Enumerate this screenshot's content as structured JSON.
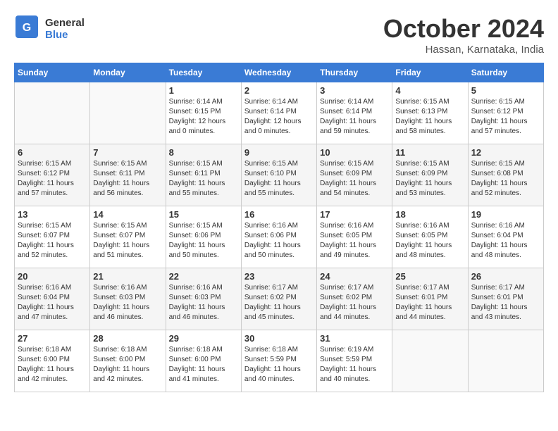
{
  "header": {
    "logo": {
      "general": "General",
      "blue": "Blue"
    },
    "title": "October 2024",
    "location": "Hassan, Karnataka, India"
  },
  "calendar": {
    "days_of_week": [
      "Sunday",
      "Monday",
      "Tuesday",
      "Wednesday",
      "Thursday",
      "Friday",
      "Saturday"
    ],
    "weeks": [
      [
        {
          "day": "",
          "sunrise": "",
          "sunset": "",
          "daylight": ""
        },
        {
          "day": "",
          "sunrise": "",
          "sunset": "",
          "daylight": ""
        },
        {
          "day": "1",
          "sunrise": "Sunrise: 6:14 AM",
          "sunset": "Sunset: 6:15 PM",
          "daylight": "Daylight: 12 hours and 0 minutes."
        },
        {
          "day": "2",
          "sunrise": "Sunrise: 6:14 AM",
          "sunset": "Sunset: 6:14 PM",
          "daylight": "Daylight: 12 hours and 0 minutes."
        },
        {
          "day": "3",
          "sunrise": "Sunrise: 6:14 AM",
          "sunset": "Sunset: 6:14 PM",
          "daylight": "Daylight: 11 hours and 59 minutes."
        },
        {
          "day": "4",
          "sunrise": "Sunrise: 6:15 AM",
          "sunset": "Sunset: 6:13 PM",
          "daylight": "Daylight: 11 hours and 58 minutes."
        },
        {
          "day": "5",
          "sunrise": "Sunrise: 6:15 AM",
          "sunset": "Sunset: 6:12 PM",
          "daylight": "Daylight: 11 hours and 57 minutes."
        }
      ],
      [
        {
          "day": "6",
          "sunrise": "Sunrise: 6:15 AM",
          "sunset": "Sunset: 6:12 PM",
          "daylight": "Daylight: 11 hours and 57 minutes."
        },
        {
          "day": "7",
          "sunrise": "Sunrise: 6:15 AM",
          "sunset": "Sunset: 6:11 PM",
          "daylight": "Daylight: 11 hours and 56 minutes."
        },
        {
          "day": "8",
          "sunrise": "Sunrise: 6:15 AM",
          "sunset": "Sunset: 6:11 PM",
          "daylight": "Daylight: 11 hours and 55 minutes."
        },
        {
          "day": "9",
          "sunrise": "Sunrise: 6:15 AM",
          "sunset": "Sunset: 6:10 PM",
          "daylight": "Daylight: 11 hours and 55 minutes."
        },
        {
          "day": "10",
          "sunrise": "Sunrise: 6:15 AM",
          "sunset": "Sunset: 6:09 PM",
          "daylight": "Daylight: 11 hours and 54 minutes."
        },
        {
          "day": "11",
          "sunrise": "Sunrise: 6:15 AM",
          "sunset": "Sunset: 6:09 PM",
          "daylight": "Daylight: 11 hours and 53 minutes."
        },
        {
          "day": "12",
          "sunrise": "Sunrise: 6:15 AM",
          "sunset": "Sunset: 6:08 PM",
          "daylight": "Daylight: 11 hours and 52 minutes."
        }
      ],
      [
        {
          "day": "13",
          "sunrise": "Sunrise: 6:15 AM",
          "sunset": "Sunset: 6:07 PM",
          "daylight": "Daylight: 11 hours and 52 minutes."
        },
        {
          "day": "14",
          "sunrise": "Sunrise: 6:15 AM",
          "sunset": "Sunset: 6:07 PM",
          "daylight": "Daylight: 11 hours and 51 minutes."
        },
        {
          "day": "15",
          "sunrise": "Sunrise: 6:15 AM",
          "sunset": "Sunset: 6:06 PM",
          "daylight": "Daylight: 11 hours and 50 minutes."
        },
        {
          "day": "16",
          "sunrise": "Sunrise: 6:16 AM",
          "sunset": "Sunset: 6:06 PM",
          "daylight": "Daylight: 11 hours and 50 minutes."
        },
        {
          "day": "17",
          "sunrise": "Sunrise: 6:16 AM",
          "sunset": "Sunset: 6:05 PM",
          "daylight": "Daylight: 11 hours and 49 minutes."
        },
        {
          "day": "18",
          "sunrise": "Sunrise: 6:16 AM",
          "sunset": "Sunset: 6:05 PM",
          "daylight": "Daylight: 11 hours and 48 minutes."
        },
        {
          "day": "19",
          "sunrise": "Sunrise: 6:16 AM",
          "sunset": "Sunset: 6:04 PM",
          "daylight": "Daylight: 11 hours and 48 minutes."
        }
      ],
      [
        {
          "day": "20",
          "sunrise": "Sunrise: 6:16 AM",
          "sunset": "Sunset: 6:04 PM",
          "daylight": "Daylight: 11 hours and 47 minutes."
        },
        {
          "day": "21",
          "sunrise": "Sunrise: 6:16 AM",
          "sunset": "Sunset: 6:03 PM",
          "daylight": "Daylight: 11 hours and 46 minutes."
        },
        {
          "day": "22",
          "sunrise": "Sunrise: 6:16 AM",
          "sunset": "Sunset: 6:03 PM",
          "daylight": "Daylight: 11 hours and 46 minutes."
        },
        {
          "day": "23",
          "sunrise": "Sunrise: 6:17 AM",
          "sunset": "Sunset: 6:02 PM",
          "daylight": "Daylight: 11 hours and 45 minutes."
        },
        {
          "day": "24",
          "sunrise": "Sunrise: 6:17 AM",
          "sunset": "Sunset: 6:02 PM",
          "daylight": "Daylight: 11 hours and 44 minutes."
        },
        {
          "day": "25",
          "sunrise": "Sunrise: 6:17 AM",
          "sunset": "Sunset: 6:01 PM",
          "daylight": "Daylight: 11 hours and 44 minutes."
        },
        {
          "day": "26",
          "sunrise": "Sunrise: 6:17 AM",
          "sunset": "Sunset: 6:01 PM",
          "daylight": "Daylight: 11 hours and 43 minutes."
        }
      ],
      [
        {
          "day": "27",
          "sunrise": "Sunrise: 6:18 AM",
          "sunset": "Sunset: 6:00 PM",
          "daylight": "Daylight: 11 hours and 42 minutes."
        },
        {
          "day": "28",
          "sunrise": "Sunrise: 6:18 AM",
          "sunset": "Sunset: 6:00 PM",
          "daylight": "Daylight: 11 hours and 42 minutes."
        },
        {
          "day": "29",
          "sunrise": "Sunrise: 6:18 AM",
          "sunset": "Sunset: 6:00 PM",
          "daylight": "Daylight: 11 hours and 41 minutes."
        },
        {
          "day": "30",
          "sunrise": "Sunrise: 6:18 AM",
          "sunset": "Sunset: 5:59 PM",
          "daylight": "Daylight: 11 hours and 40 minutes."
        },
        {
          "day": "31",
          "sunrise": "Sunrise: 6:19 AM",
          "sunset": "Sunset: 5:59 PM",
          "daylight": "Daylight: 11 hours and 40 minutes."
        },
        {
          "day": "",
          "sunrise": "",
          "sunset": "",
          "daylight": ""
        },
        {
          "day": "",
          "sunrise": "",
          "sunset": "",
          "daylight": ""
        }
      ]
    ]
  }
}
